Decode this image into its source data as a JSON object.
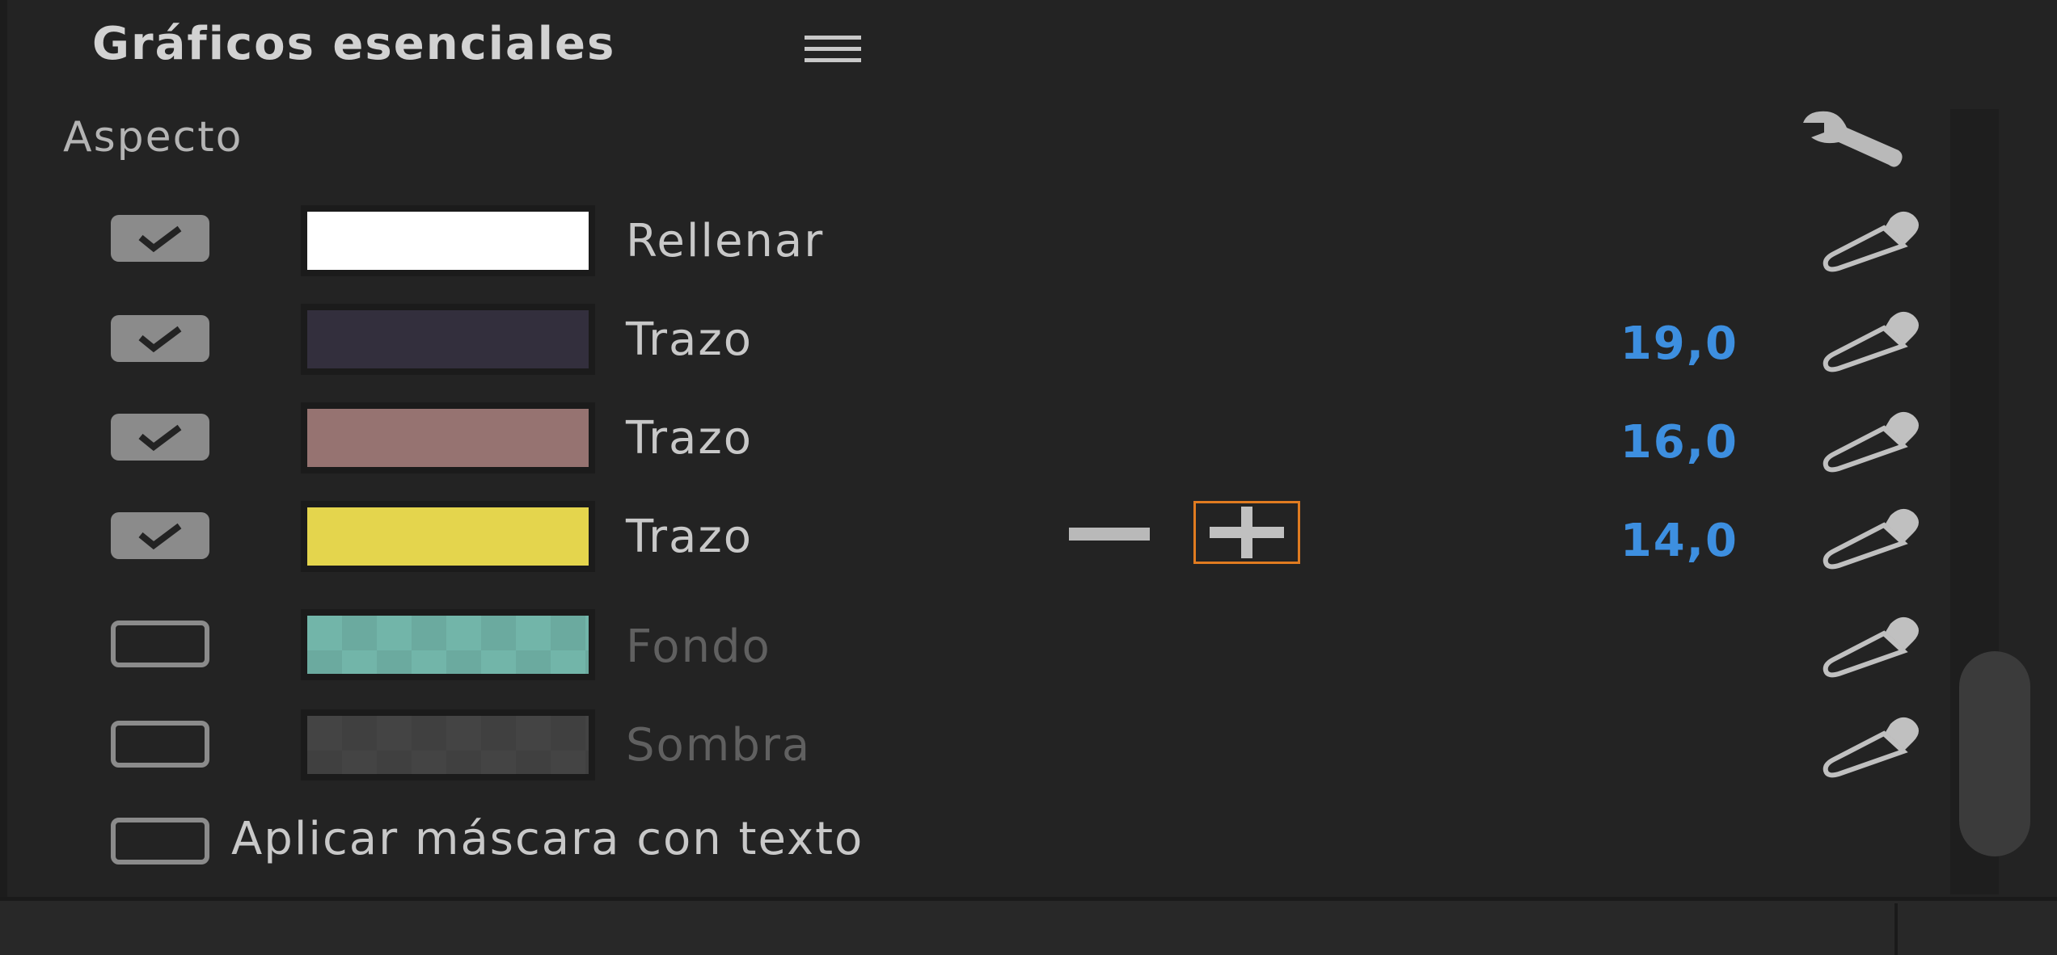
{
  "panel": {
    "title": "Gráficos esenciales"
  },
  "section": {
    "title": "Aspecto"
  },
  "rows": [
    {
      "checked": true,
      "color": "#ffffff",
      "label": "Rellenar",
      "value": "",
      "enabled": true
    },
    {
      "checked": true,
      "color": "#332f3d",
      "label": "Trazo",
      "value": "19,0",
      "enabled": true
    },
    {
      "checked": true,
      "color": "#967371",
      "label": "Trazo",
      "value": "16,0",
      "enabled": true
    },
    {
      "checked": true,
      "color": "#e4d54d",
      "label": "Trazo",
      "value": "14,0",
      "enabled": true
    },
    {
      "checked": false,
      "color": "#72b5a9",
      "label": "Fondo",
      "value": "",
      "enabled": false
    },
    {
      "checked": false,
      "color": "#444444",
      "label": "Sombra",
      "value": "",
      "enabled": false
    }
  ],
  "mask": {
    "label": "Aplicar máscara con texto",
    "checked": false
  },
  "icons": {
    "menu": "hamburger-icon",
    "wrench": "wrench-icon",
    "dropper": "eyedropper-icon",
    "remove": "minus-icon",
    "add": "plus-icon",
    "check": "checkmark-icon"
  },
  "colors": {
    "value_text": "#3d8fe0",
    "focus_outline": "#e07b20"
  }
}
